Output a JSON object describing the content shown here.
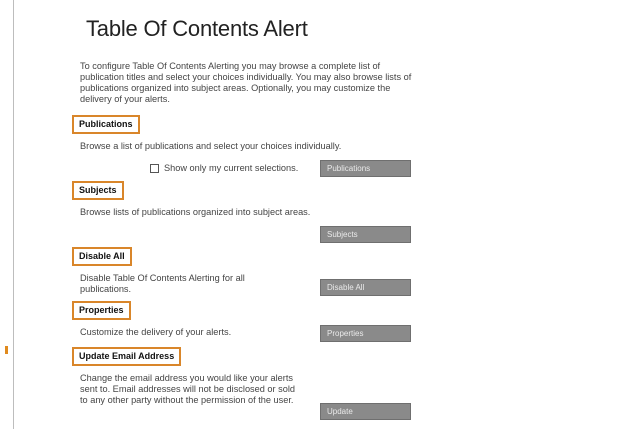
{
  "page": {
    "title": "Table Of Contents Alert",
    "intro": "To configure Table Of Contents Alerting you may browse a complete list of publication titles and select your choices individually. You may also browse lists of publications organized into subject areas. Optionally, you may customize the delivery of your alerts."
  },
  "sections": {
    "publications": {
      "heading": "Publications",
      "description": "Browse a list of publications and select your choices individually.",
      "checkbox_label": "Show only my current selections.",
      "checkbox_checked": false,
      "button_label": "Publications"
    },
    "subjects": {
      "heading": "Subjects",
      "description": "Browse lists of publications organized into subject areas.",
      "button_label": "Subjects"
    },
    "disable_all": {
      "heading": "Disable All",
      "description": "Disable Table Of Contents Alerting for all publications.",
      "button_label": "Disable All"
    },
    "properties": {
      "heading": "Properties",
      "description": "Customize the delivery of your alerts.",
      "button_label": "Properties"
    },
    "update_email": {
      "heading": "Update Email Address",
      "description": "Change the email address you would like your alerts sent to. Email addresses will not be disclosed or sold to any other party without the permission of the user.",
      "button_label": "Update"
    }
  },
  "colors": {
    "highlight_border": "#d9862a",
    "button_background": "#8a8a8a",
    "button_text": "#eaeaea"
  }
}
